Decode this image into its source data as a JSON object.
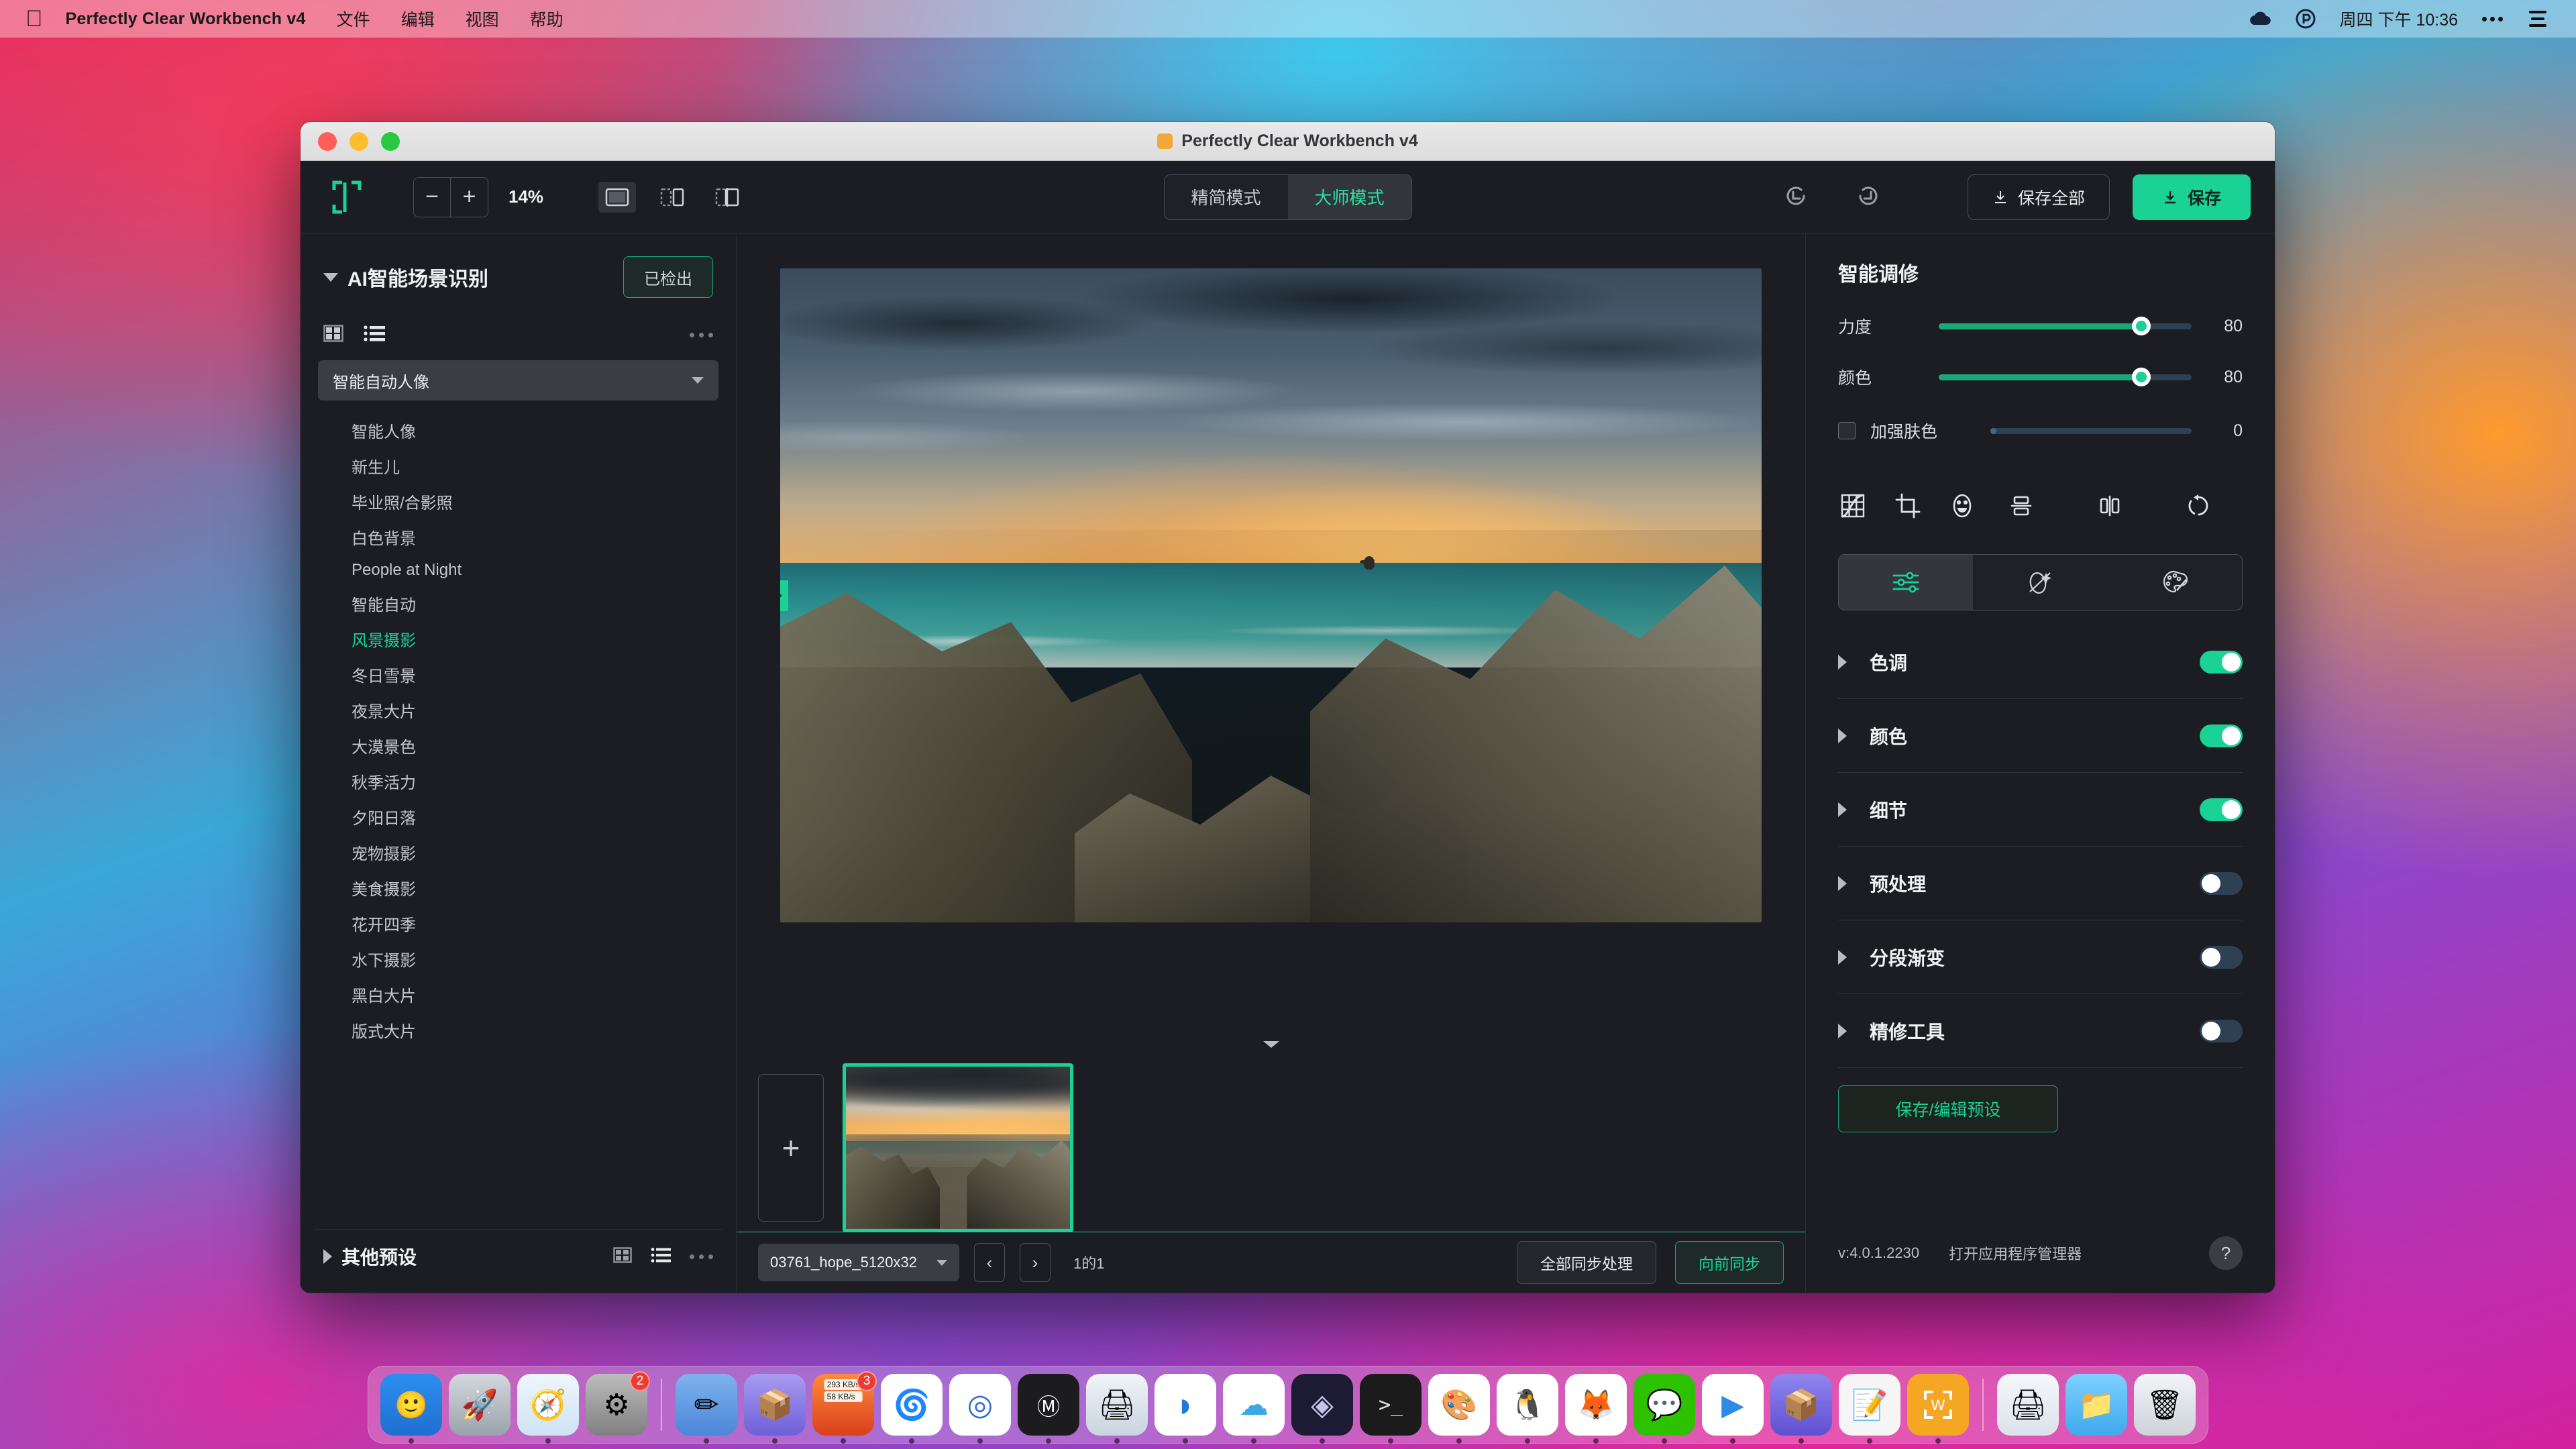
{
  "menubar": {
    "apple_icon": "apple-logo",
    "app_title": "Perfectly Clear Workbench v4",
    "items": [
      {
        "label": "文件"
      },
      {
        "label": "编辑"
      },
      {
        "label": "视图"
      },
      {
        "label": "帮助"
      }
    ],
    "status_icons": [
      "cloud-icon",
      "shield-p-icon"
    ],
    "clock": "周四 下午 10:36",
    "more_icon": "ellipsis-icon",
    "control_center_icon": "control-center-icon"
  },
  "window": {
    "title": "Perfectly Clear Workbench v4",
    "traffic_lights": [
      "close",
      "minimize",
      "zoom"
    ]
  },
  "toolbar": {
    "logo_icon": "bracket-frame-icon",
    "zoom_out_label": "−",
    "zoom_in_label": "+",
    "zoom_level": "14%",
    "view_modes": [
      {
        "name": "single-view-icon",
        "active": true
      },
      {
        "name": "split-view-icon",
        "active": false
      },
      {
        "name": "split-overlay-icon",
        "active": false
      }
    ],
    "modes": [
      {
        "label": "精简模式",
        "active": false
      },
      {
        "label": "大师模式",
        "active": true
      }
    ],
    "undo_icon": "undo-icon",
    "redo_icon": "redo-icon",
    "save_all_label": "保存全部",
    "save_label": "保存"
  },
  "sidebar": {
    "section_title": "AI智能场景识别",
    "detect_button": "已检出",
    "view_grid_icon": "grid-view-icon",
    "view_list_icon": "list-view-icon",
    "more_icon": "ellipsis-icon",
    "selected_preset": "智能自动人像",
    "presets": [
      {
        "label": "智能人像",
        "selected": false
      },
      {
        "label": "新生儿",
        "selected": false
      },
      {
        "label": "毕业照/合影照",
        "selected": false
      },
      {
        "label": "白色背景",
        "selected": false
      },
      {
        "label": "People at Night",
        "selected": false
      },
      {
        "label": "智能自动",
        "selected": false
      },
      {
        "label": "风景摄影",
        "selected": true
      },
      {
        "label": "冬日雪景",
        "selected": false
      },
      {
        "label": "夜景大片",
        "selected": false
      },
      {
        "label": "大漠景色",
        "selected": false
      },
      {
        "label": "秋季活力",
        "selected": false
      },
      {
        "label": "夕阳日落",
        "selected": false
      },
      {
        "label": "宠物摄影",
        "selected": false
      },
      {
        "label": "美食摄影",
        "selected": false
      },
      {
        "label": "花开四季",
        "selected": false
      },
      {
        "label": "水下摄影",
        "selected": false
      },
      {
        "label": "黑白大片",
        "selected": false
      },
      {
        "label": "版式大片",
        "selected": false
      }
    ],
    "footer_title": "其他预设"
  },
  "canvas": {
    "image_alt": "rocky-seashore-sunset-photo",
    "compare_handle_icon": "compare-handle-icon",
    "collapse_icon": "chevron-down-icon"
  },
  "filmstrip": {
    "add_label": "+",
    "thumbnails": [
      {
        "name": "03761_hope_5120x32",
        "selected": true
      }
    ]
  },
  "bottombar": {
    "file_name": "03761_hope_5120x32",
    "prev_icon": "chevron-left-icon",
    "next_icon": "chevron-right-icon",
    "page_indicator": "1的1",
    "sync_all_label": "全部同步处理",
    "sync_forward_label": "向前同步"
  },
  "rightpanel": {
    "title": "智能调修",
    "sliders": [
      {
        "label": "力度",
        "value": "80",
        "percent": 80
      },
      {
        "label": "颜色",
        "value": "80",
        "percent": 80
      }
    ],
    "checkbox_row": {
      "label": "加强肤色",
      "value": "0",
      "percent": 3,
      "checked": false
    },
    "tool_icons_left": [
      "curves-icon",
      "crop-icon",
      "face-icon"
    ],
    "tool_icons_right": [
      "flip-vertical-icon",
      "flip-horizontal-icon",
      "rotate-icon"
    ],
    "tabs": [
      {
        "icon": "sliders-icon",
        "active": true
      },
      {
        "icon": "magic-wand-icon",
        "active": false
      },
      {
        "icon": "palette-icon",
        "active": false
      }
    ],
    "accordion": [
      {
        "label": "色调",
        "on": true
      },
      {
        "label": "颜色",
        "on": true
      },
      {
        "label": "细节",
        "on": true
      },
      {
        "label": "预处理",
        "on": false
      },
      {
        "label": "分段渐变",
        "on": false
      },
      {
        "label": "精修工具",
        "on": false
      }
    ],
    "preset_button": "保存/编辑预设",
    "version": "v:4.0.1.2230",
    "app_manager_link": "打开应用程序管理器",
    "help_icon": "help-icon"
  },
  "dock": {
    "items": [
      {
        "name": "finder",
        "glyph": "🙂",
        "bg": "#2b8ff0",
        "running": true
      },
      {
        "name": "launchpad",
        "glyph": "🚀",
        "bg": "#9aa2ab",
        "running": false
      },
      {
        "name": "safari",
        "glyph": "🧭",
        "bg": "#e8f2fb",
        "running": true
      },
      {
        "name": "system-settings",
        "glyph": "⚙",
        "bg": "#9b9b9b",
        "running": false,
        "badge": "2"
      },
      {
        "name": "separator-1",
        "glyph": "",
        "bg": "",
        "running": false
      },
      {
        "name": "notes-pen",
        "glyph": "✏",
        "bg": "#5b9ae8",
        "running": true
      },
      {
        "name": "keka-archiver",
        "glyph": "📦",
        "bg": "#8f7fe8",
        "running": true
      },
      {
        "name": "network-monitor",
        "glyph": "",
        "bg": "#e85b2b",
        "running": true,
        "badge": "3",
        "net_down": "293 KB/s",
        "net_up": "58 KB/s"
      },
      {
        "name": "microsoft-edge",
        "glyph": "🌀",
        "bg": "#ffffff",
        "running": true
      },
      {
        "name": "qiye-app",
        "glyph": "◎",
        "bg": "#ffffff",
        "running": true
      },
      {
        "name": "movist",
        "glyph": "Ⓜ",
        "bg": "#1c1c1e",
        "running": true
      },
      {
        "name": "printer-util",
        "glyph": "🖨",
        "bg": "#e9eef4",
        "running": true
      },
      {
        "name": "parallels",
        "glyph": "◗",
        "bg": "#ffffff",
        "running": true
      },
      {
        "name": "cloud-sync",
        "glyph": "☁",
        "bg": "#ffffff",
        "running": true
      },
      {
        "name": "obsidian",
        "glyph": "◈",
        "bg": "#1d1b33",
        "running": true
      },
      {
        "name": "terminal",
        "glyph": ">_",
        "bg": "#1b1b1b",
        "running": true
      },
      {
        "name": "pixelmator",
        "glyph": "🎨",
        "bg": "#ffffff",
        "running": true
      },
      {
        "name": "qq",
        "glyph": "🐧",
        "bg": "#ffffff",
        "running": true
      },
      {
        "name": "foxmail",
        "glyph": "🦊",
        "bg": "#ffffff",
        "running": true
      },
      {
        "name": "wechat",
        "glyph": "💬",
        "bg": "#2dc100",
        "running": true
      },
      {
        "name": "potplayer",
        "glyph": "▶",
        "bg": "#ffffff",
        "running": true
      },
      {
        "name": "betterzip",
        "glyph": "📦",
        "bg": "#7b6be8",
        "running": true
      },
      {
        "name": "notepad",
        "glyph": "📝",
        "bg": "#f2f2f2",
        "running": true
      },
      {
        "name": "perfectly-clear-workbench",
        "glyph": "W",
        "bg": "#f5a623",
        "running": true
      },
      {
        "name": "separator-2",
        "glyph": "",
        "bg": "",
        "running": false
      },
      {
        "name": "scanner",
        "glyph": "🖨",
        "bg": "#eef1f5",
        "running": false
      },
      {
        "name": "downloads-folder",
        "glyph": "📁",
        "bg": "#63c2ff",
        "running": false
      },
      {
        "name": "trash",
        "glyph": "🗑",
        "bg": "#dfe3e8",
        "running": false
      }
    ]
  },
  "colors": {
    "accent_green": "#19d294",
    "panel_bg": "#1b1d22",
    "slider_track": "#2d4152"
  }
}
